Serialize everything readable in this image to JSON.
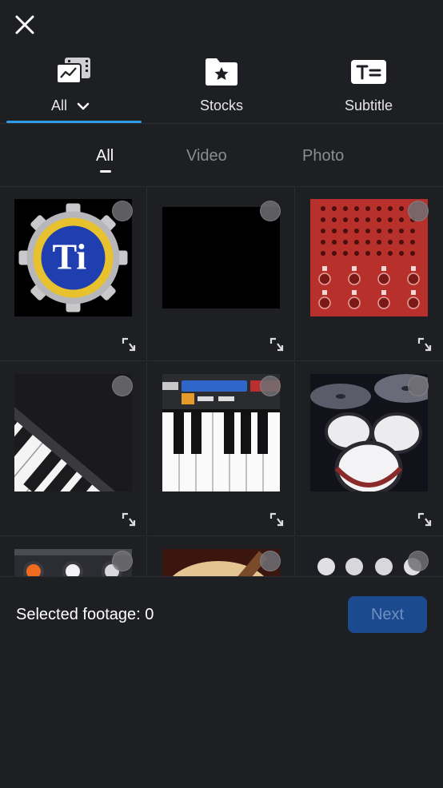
{
  "top_tabs": [
    {
      "label": "All",
      "icon": "media-library-icon",
      "active": true
    },
    {
      "label": "Stocks",
      "icon": "star-folder-icon",
      "active": false
    },
    {
      "label": "Subtitle",
      "icon": "text-subtitle-icon",
      "active": false
    }
  ],
  "sub_tabs": [
    {
      "label": "All",
      "active": true
    },
    {
      "label": "Video",
      "active": false
    },
    {
      "label": "Photo",
      "active": false
    }
  ],
  "media_items": [
    {
      "icon": "titanium-app-icon"
    },
    {
      "icon": "black-video-thumbnail"
    },
    {
      "icon": "drum-pad-app-icon"
    },
    {
      "icon": "piano-keys-angled-icon"
    },
    {
      "icon": "synth-keyboard-icon"
    },
    {
      "icon": "drum-kit-icon"
    },
    {
      "icon": "audio-mixer-icon"
    },
    {
      "icon": "acoustic-guitar-icon"
    },
    {
      "icon": "knobs-panel-icon"
    }
  ],
  "footer": {
    "selected_label": "Selected footage: 0",
    "next_label": "Next"
  },
  "colors": {
    "accent": "#2f9ce8",
    "background": "#1e1f23",
    "next_button": "#1b4a8f"
  }
}
